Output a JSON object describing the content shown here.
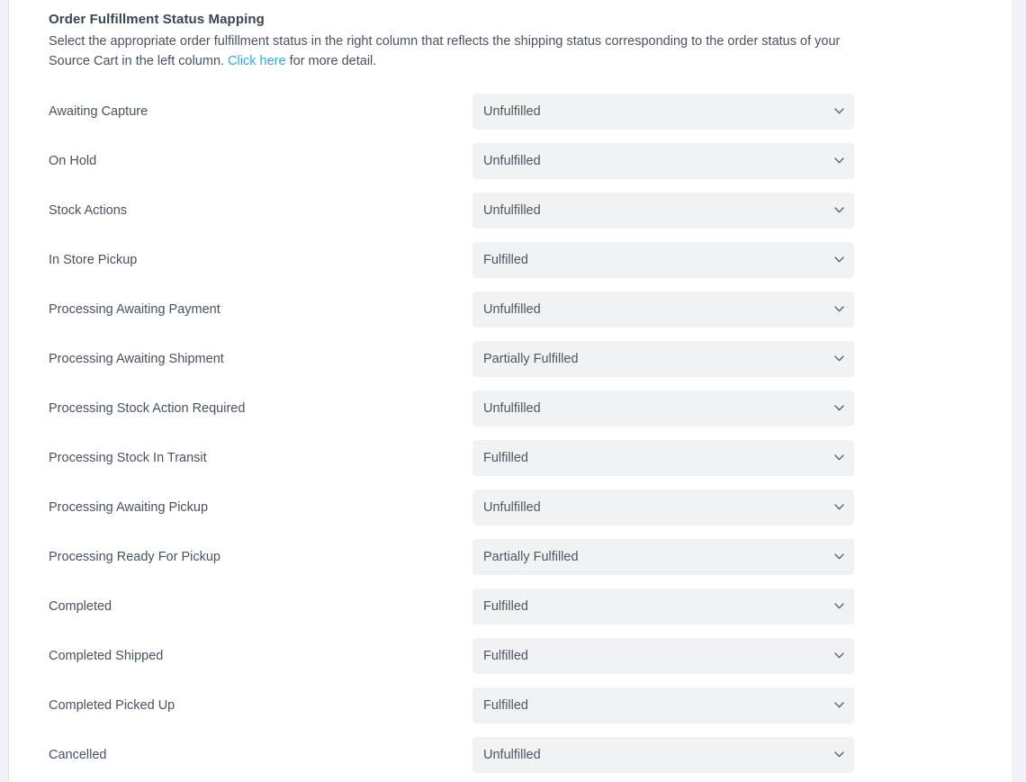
{
  "panel": {
    "title": "Order Fulfillment Status Mapping",
    "description_part1": "Select the appropriate order fulfillment status in the right column that reflects the shipping status corresponding to the order status of your Source Cart in the left column.",
    "link_text": "Click here",
    "description_part2": "for more detail.",
    "link_color": "#2fa8e0"
  },
  "select_options": [
    "Unfulfilled",
    "Partially Fulfilled",
    "Fulfilled"
  ],
  "dropdown_icon": "chevron-down-icon",
  "mappings": [
    {
      "source_status": "Awaiting Capture",
      "fulfillment_status": "Unfulfilled"
    },
    {
      "source_status": "On Hold",
      "fulfillment_status": "Unfulfilled"
    },
    {
      "source_status": "Stock Actions",
      "fulfillment_status": "Unfulfilled"
    },
    {
      "source_status": "In Store Pickup",
      "fulfillment_status": "Fulfilled"
    },
    {
      "source_status": "Processing Awaiting Payment",
      "fulfillment_status": "Unfulfilled"
    },
    {
      "source_status": "Processing Awaiting Shipment",
      "fulfillment_status": "Partially Fulfilled"
    },
    {
      "source_status": "Processing Stock Action Required",
      "fulfillment_status": "Unfulfilled"
    },
    {
      "source_status": "Processing Stock In Transit",
      "fulfillment_status": "Fulfilled"
    },
    {
      "source_status": "Processing Awaiting Pickup",
      "fulfillment_status": "Unfulfilled"
    },
    {
      "source_status": "Processing Ready For Pickup",
      "fulfillment_status": "Partially Fulfilled"
    },
    {
      "source_status": "Completed",
      "fulfillment_status": "Fulfilled"
    },
    {
      "source_status": "Completed Shipped",
      "fulfillment_status": "Fulfilled"
    },
    {
      "source_status": "Completed Picked Up",
      "fulfillment_status": "Fulfilled"
    },
    {
      "source_status": "Cancelled",
      "fulfillment_status": "Unfulfilled"
    }
  ]
}
